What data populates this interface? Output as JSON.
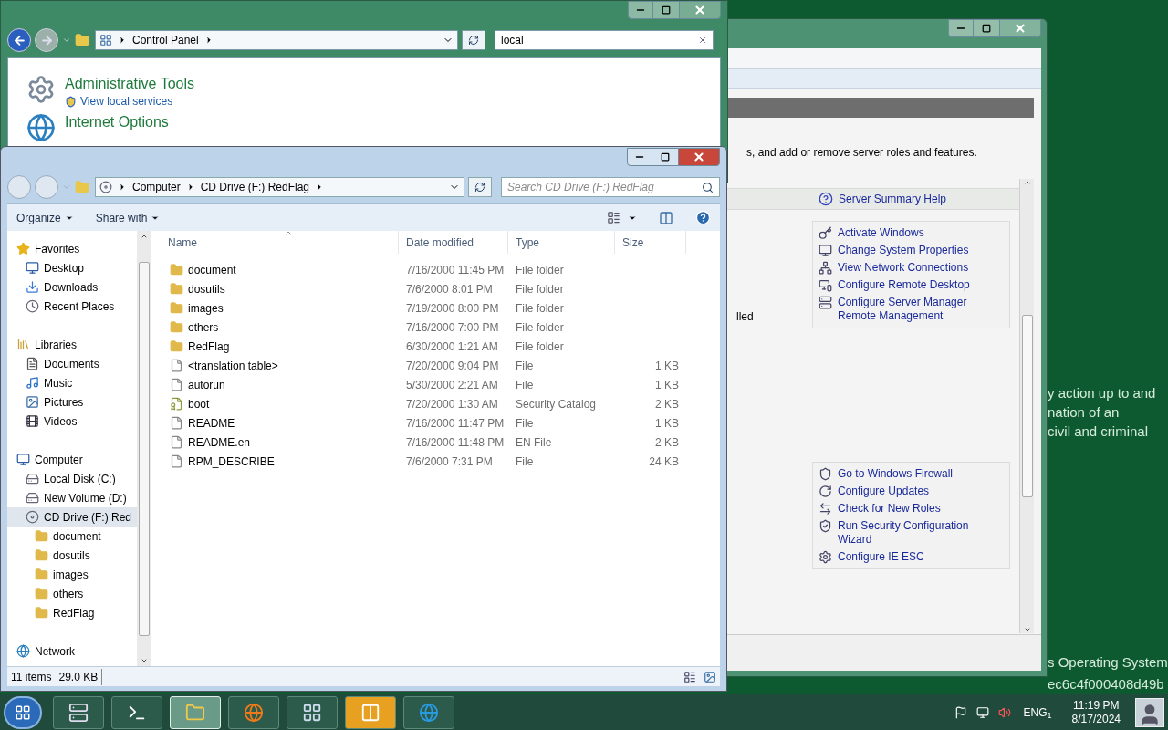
{
  "desktop_text": {
    "upper": [
      "y action up to and",
      "nation of an",
      "civil and criminal"
    ],
    "lower": [
      "s Operating System",
      "ec6c4f000408d49b"
    ]
  },
  "server_manager": {
    "description": "s, and add or remove server roles and features.",
    "partial_text": "lled",
    "help_link": "Server Summary Help",
    "link_groups": [
      [
        {
          "label": "Activate Windows",
          "kind": "key"
        },
        {
          "label": "Change System Properties",
          "kind": "computer"
        },
        {
          "label": "View Network Connections",
          "kind": "network"
        },
        {
          "label": "Configure Remote Desktop",
          "kind": "remote"
        },
        {
          "label": "Configure Server Manager Remote Management",
          "kind": "server"
        }
      ],
      [
        {
          "label": "Go to Windows Firewall",
          "kind": "firewall"
        },
        {
          "label": "Configure Updates",
          "kind": "update"
        },
        {
          "label": "Check for New Roles",
          "kind": "roles"
        },
        {
          "label": "Run Security Configuration Wizard",
          "kind": "security"
        },
        {
          "label": "Configure IE ESC",
          "kind": "ie"
        }
      ]
    ]
  },
  "control_panel": {
    "breadcrumb": [
      "Control Panel"
    ],
    "search": "local",
    "items": [
      {
        "kind": "tools",
        "title": "Administrative Tools",
        "task": "View local services"
      },
      {
        "kind": "internet",
        "title": "Internet Options"
      }
    ]
  },
  "explorer": {
    "breadcrumb": [
      "Computer",
      "CD Drive (F:) RedFlag"
    ],
    "search_placeholder": "Search CD Drive (F:) RedFlag",
    "toolbar": [
      "Organize",
      "Share with"
    ],
    "nav": [
      {
        "label": "Favorites",
        "kind": "star",
        "selected": false,
        "children": [
          {
            "label": "Desktop",
            "kind": "desktop",
            "selected": false
          },
          {
            "label": "Downloads",
            "kind": "downloads",
            "selected": false
          },
          {
            "label": "Recent Places",
            "kind": "recent",
            "selected": false
          }
        ]
      },
      {
        "label": "Libraries",
        "kind": "library",
        "selected": false,
        "children": [
          {
            "label": "Documents",
            "kind": "documents",
            "selected": false
          },
          {
            "label": "Music",
            "kind": "music",
            "selected": false
          },
          {
            "label": "Pictures",
            "kind": "pictures",
            "selected": false
          },
          {
            "label": "Videos",
            "kind": "videos",
            "selected": false
          }
        ]
      },
      {
        "label": "Computer",
        "kind": "computer",
        "selected": false,
        "children": [
          {
            "label": "Local Disk (C:)",
            "kind": "disk",
            "selected": false
          },
          {
            "label": "New Volume (D:)",
            "kind": "disk",
            "selected": false
          },
          {
            "label": "CD Drive (F:) Red",
            "kind": "cd",
            "selected": true,
            "children": [
              {
                "label": "document",
                "kind": "folder",
                "selected": false
              },
              {
                "label": "dosutils",
                "kind": "folder",
                "selected": false
              },
              {
                "label": "images",
                "kind": "folder",
                "selected": false
              },
              {
                "label": "others",
                "kind": "folder",
                "selected": false
              },
              {
                "label": "RedFlag",
                "kind": "folder",
                "selected": false
              }
            ]
          }
        ]
      },
      {
        "label": "Network",
        "kind": "network",
        "selected": false
      }
    ],
    "columns": [
      "Name",
      "Date modified",
      "Type",
      "Size"
    ],
    "rows": [
      {
        "kind": "folder",
        "name": "document",
        "date": "7/16/2000 11:45 PM",
        "type": "File folder"
      },
      {
        "kind": "folder",
        "name": "dosutils",
        "date": "7/6/2000 8:01 PM",
        "type": "File folder"
      },
      {
        "kind": "folder",
        "name": "images",
        "date": "7/19/2000 8:00 PM",
        "type": "File folder"
      },
      {
        "kind": "folder",
        "name": "others",
        "date": "7/16/2000 7:00 PM",
        "type": "File folder"
      },
      {
        "kind": "folder",
        "name": "RedFlag",
        "date": "6/30/2000 1:21 AM",
        "type": "File folder"
      },
      {
        "kind": "file",
        "name": "<translation table>",
        "date": "7/20/2000 9:04 PM",
        "type": "File",
        "size": "1 KB"
      },
      {
        "kind": "file",
        "name": "autorun",
        "date": "5/30/2000 2:21 AM",
        "type": "File",
        "size": "1 KB"
      },
      {
        "kind": "catalog",
        "name": "boot",
        "date": "7/20/2000 1:30 AM",
        "type": "Security Catalog",
        "size": "2 KB"
      },
      {
        "kind": "file",
        "name": "README",
        "date": "7/16/2000 11:47 PM",
        "type": "File",
        "size": "1 KB"
      },
      {
        "kind": "file",
        "name": "README.en",
        "date": "7/16/2000 11:48 PM",
        "type": "EN File",
        "size": "2 KB"
      },
      {
        "kind": "file",
        "name": "RPM_DESCRIBE",
        "date": "7/6/2000 7:31 PM",
        "type": "File",
        "size": "24 KB"
      }
    ],
    "status": {
      "count": "11 items",
      "size": "29.0 KB"
    }
  },
  "taskbar": {
    "apps": [
      {
        "kind": "server",
        "selected": false,
        "attention": false
      },
      {
        "kind": "powershell",
        "selected": false,
        "attention": false
      },
      {
        "kind": "explorer",
        "selected": true,
        "attention": false
      },
      {
        "kind": "firefox",
        "selected": false,
        "attention": false
      },
      {
        "kind": "control",
        "selected": false,
        "attention": false
      },
      {
        "kind": "window",
        "selected": false,
        "attention": true
      },
      {
        "kind": "ie",
        "selected": false,
        "attention": false
      }
    ],
    "language": "ENG$_{1}$",
    "time": "11:19 PM",
    "date": "8/17/2024"
  }
}
